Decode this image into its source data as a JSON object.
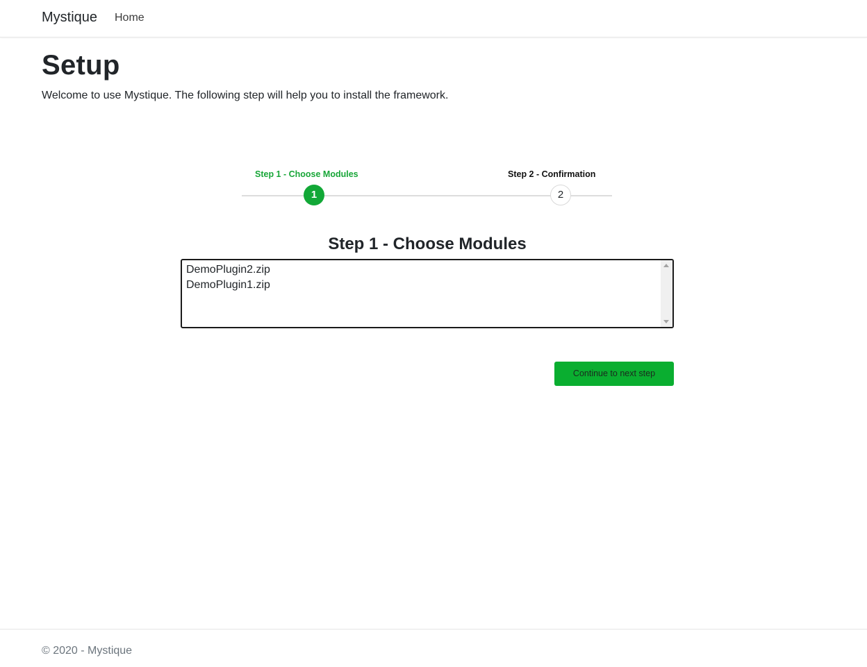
{
  "navbar": {
    "brand": "Mystique",
    "links": [
      {
        "label": "Home"
      }
    ]
  },
  "page": {
    "title": "Setup",
    "intro": "Welcome to use Mystique. The following step will help you to install the framework."
  },
  "stepper": {
    "steps": [
      {
        "label": "Step 1 - Choose Modules",
        "number": "1",
        "state": "active"
      },
      {
        "label": "Step 2 - Confirmation",
        "number": "2",
        "state": "pending"
      }
    ]
  },
  "section": {
    "title": "Step 1 - Choose Modules",
    "modules": [
      "DemoPlugin2.zip",
      "DemoPlugin1.zip"
    ]
  },
  "actions": {
    "next_label": "Continue to next step"
  },
  "footer": {
    "text": "© 2020 - Mystique"
  },
  "colors": {
    "accent": "#12a837",
    "accent_text": "#18a638",
    "button": "#0aae30"
  }
}
